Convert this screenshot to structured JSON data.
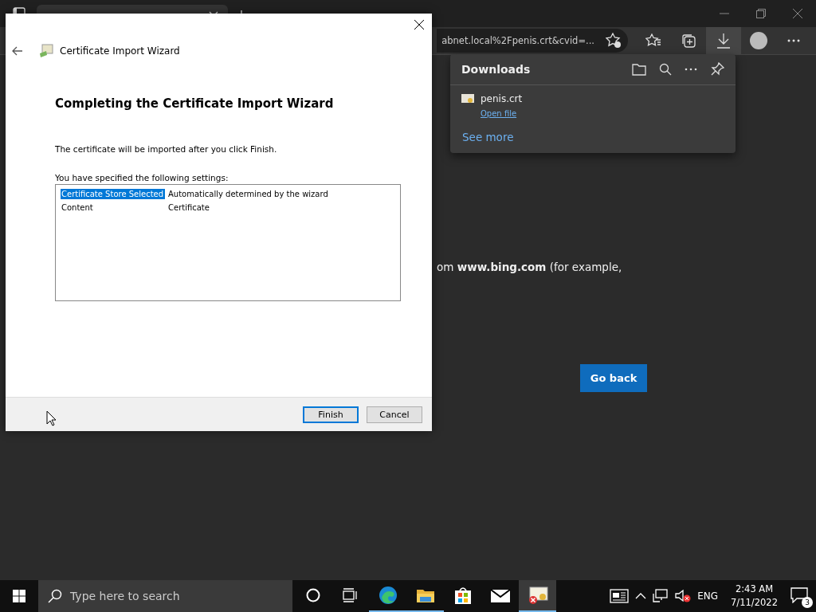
{
  "browser": {
    "address": "abnet.local%2Fpenis.crt&cvid=...",
    "downloads": {
      "title": "Downloads",
      "items": [
        {
          "name": "penis.crt",
          "action": "Open file"
        }
      ],
      "see_more": "See more"
    },
    "page": {
      "text": "om **www.bing.com** (for example,",
      "button": "Go back"
    }
  },
  "dialog": {
    "title": "Certificate Import Wizard",
    "heading": "Completing the Certificate Import Wizard",
    "info": "The certificate will be imported after you click Finish.",
    "settings_label": "You have specified the following settings:",
    "settings": [
      {
        "name": "Certificate Store Selected",
        "value": "Automatically determined by the wizard",
        "selected": true
      },
      {
        "name": "Content",
        "value": "Certificate",
        "selected": false
      }
    ],
    "buttons": [
      {
        "label": "Finish",
        "default": true
      },
      {
        "label": "Cancel",
        "default": false
      }
    ]
  },
  "taskbar": {
    "search_placeholder": "Type here to search",
    "apps": [
      {
        "kind": "edge",
        "open": true,
        "selected": false
      },
      {
        "kind": "folder",
        "open": true,
        "selected": false
      },
      {
        "kind": "store",
        "open": false,
        "selected": false
      },
      {
        "kind": "mail",
        "open": false,
        "selected": false
      },
      {
        "kind": "certificate",
        "open": true,
        "selected": true
      }
    ],
    "language": "ENG",
    "time": "2:43 AM",
    "date": "7/11/2022",
    "notifications": "3"
  }
}
